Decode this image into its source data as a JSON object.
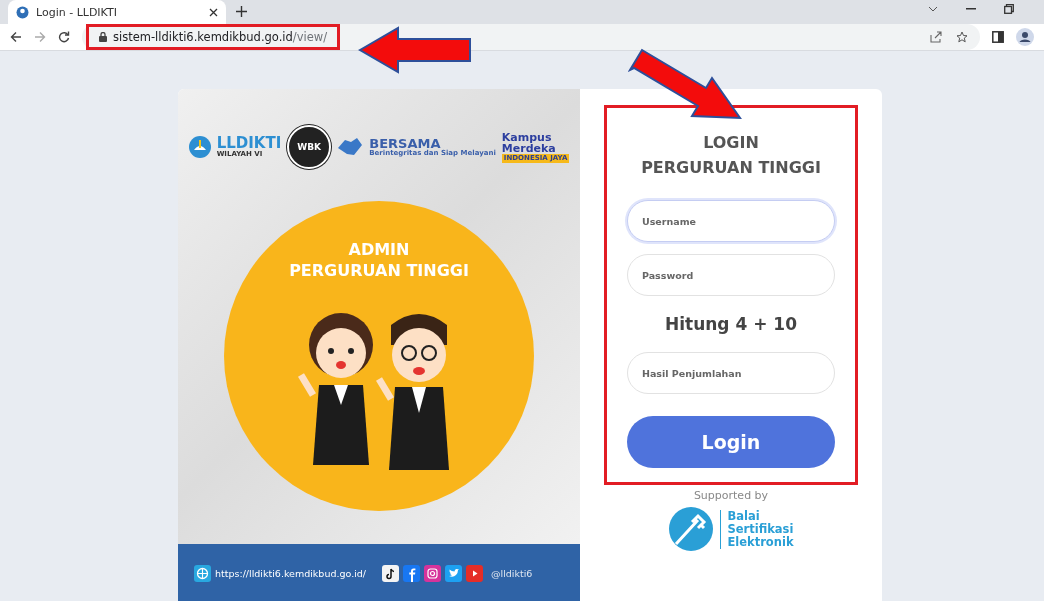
{
  "browser": {
    "tab": {
      "title": "Login - LLDIKTI",
      "selected": true
    },
    "url": {
      "host": "sistem-lldikti6.kemdikbud.go.id",
      "path": "/view/"
    }
  },
  "banner": {
    "logos": {
      "lldikti": "LLDIKTI",
      "lldikti_sub": "WILAYAH VI",
      "seal": "WBK",
      "bersama": "BERSAMA",
      "bersama_sub": "Berintegritas dan Siap Melayani",
      "kampus": "Kampus",
      "merdeka": "Merdeka",
      "merdeka_sub": "INDONESIA JAYA"
    },
    "heading": [
      "ADMIN",
      "PERGURUAN TINGGI"
    ],
    "footer": {
      "website": "https://lldikti6.kemdikbud.go.id/",
      "handle": "@lldikti6"
    }
  },
  "login": {
    "title": [
      "LOGIN",
      "PERGURUAN TINGGI"
    ],
    "fields": [
      {
        "placeholder": "Username",
        "focused": true
      },
      {
        "placeholder": "Password",
        "focused": false
      }
    ],
    "captcha": "Hitung 4 + 10",
    "answer": {
      "placeholder": "Hasil Penjumlahan",
      "focused": false
    },
    "button": "Login",
    "supported_by": "Supported by",
    "partner": [
      "Balai",
      "Sertifikasi",
      "Elektronik"
    ]
  }
}
